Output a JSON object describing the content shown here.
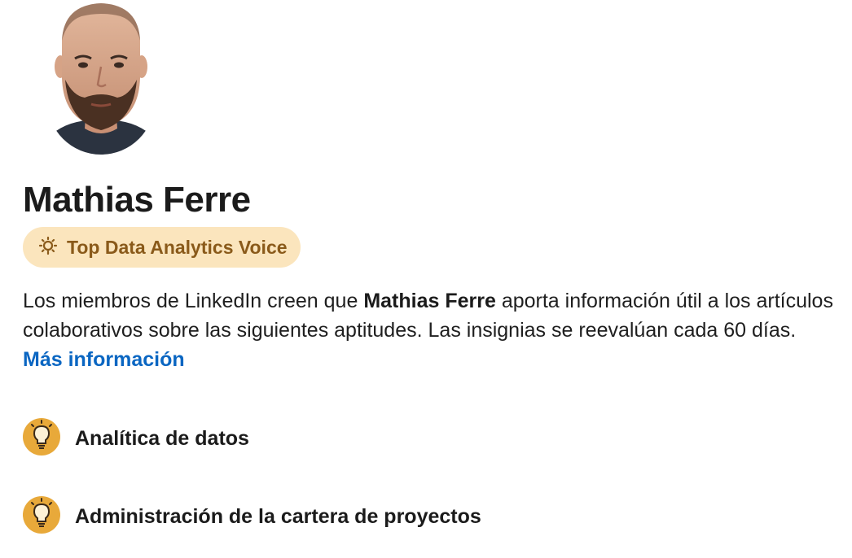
{
  "profile": {
    "name": "Mathias Ferre",
    "badge_label": "Top Data Analytics Voice",
    "badge_icon": "lightbulb-sparkle-icon",
    "badge_color": "#fbe5bd",
    "badge_text_color": "#8a5a1a"
  },
  "description": {
    "part1": "Los miembros de LinkedIn creen que ",
    "bold_name": "Mathias Ferre",
    "part2": " aporta información útil a los artículos colaborativos sobre las siguientes aptitudes. Las insignias se reevalúan cada 60 días. ",
    "link_label": "Más información",
    "link_color": "#0a66c2"
  },
  "skills": [
    {
      "label": "Analítica de datos",
      "icon": "lightbulb-icon"
    },
    {
      "label": "Administración de la cartera de proyectos",
      "icon": "lightbulb-icon"
    }
  ]
}
